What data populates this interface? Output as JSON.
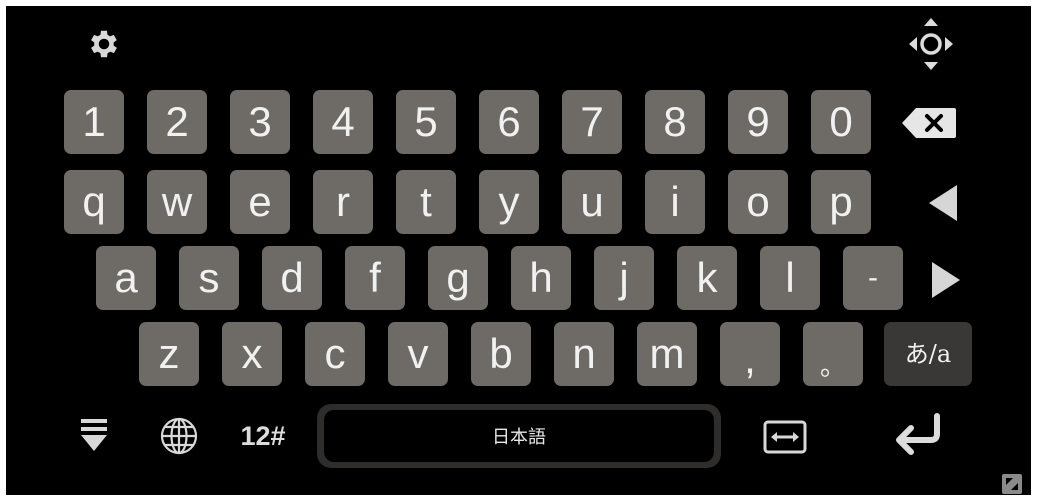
{
  "keyboard": {
    "top_bar": {
      "settings_icon": "gear-icon",
      "move_handle_icon": "move-arrows-icon"
    },
    "number_row": [
      "1",
      "2",
      "3",
      "4",
      "5",
      "6",
      "7",
      "8",
      "9",
      "0"
    ],
    "row_q": [
      "q",
      "w",
      "e",
      "r",
      "t",
      "y",
      "u",
      "i",
      "o",
      "p"
    ],
    "row_a": [
      "a",
      "s",
      "d",
      "f",
      "g",
      "h",
      "j",
      "k",
      "l",
      "-"
    ],
    "row_z": [
      "z",
      "x",
      "c",
      "v",
      "b",
      "n",
      "m",
      ",",
      "。"
    ],
    "kana_toggle_label": "あ/a",
    "bottom": {
      "hide_icon": "hide-keyboard-icon",
      "globe_icon": "globe-icon",
      "symbols_label": "12#",
      "space_label": "日本語",
      "resize_icon": "resize-width-icon",
      "enter_icon": "enter-icon"
    },
    "side_icons": {
      "backspace": "backspace-icon",
      "left": "arrow-left-icon",
      "right": "arrow-right-icon"
    },
    "colors": {
      "background": "#000000",
      "key": "#6e6b67",
      "key_dark": "#3a3836",
      "key_text": "#f1f1f1"
    }
  }
}
